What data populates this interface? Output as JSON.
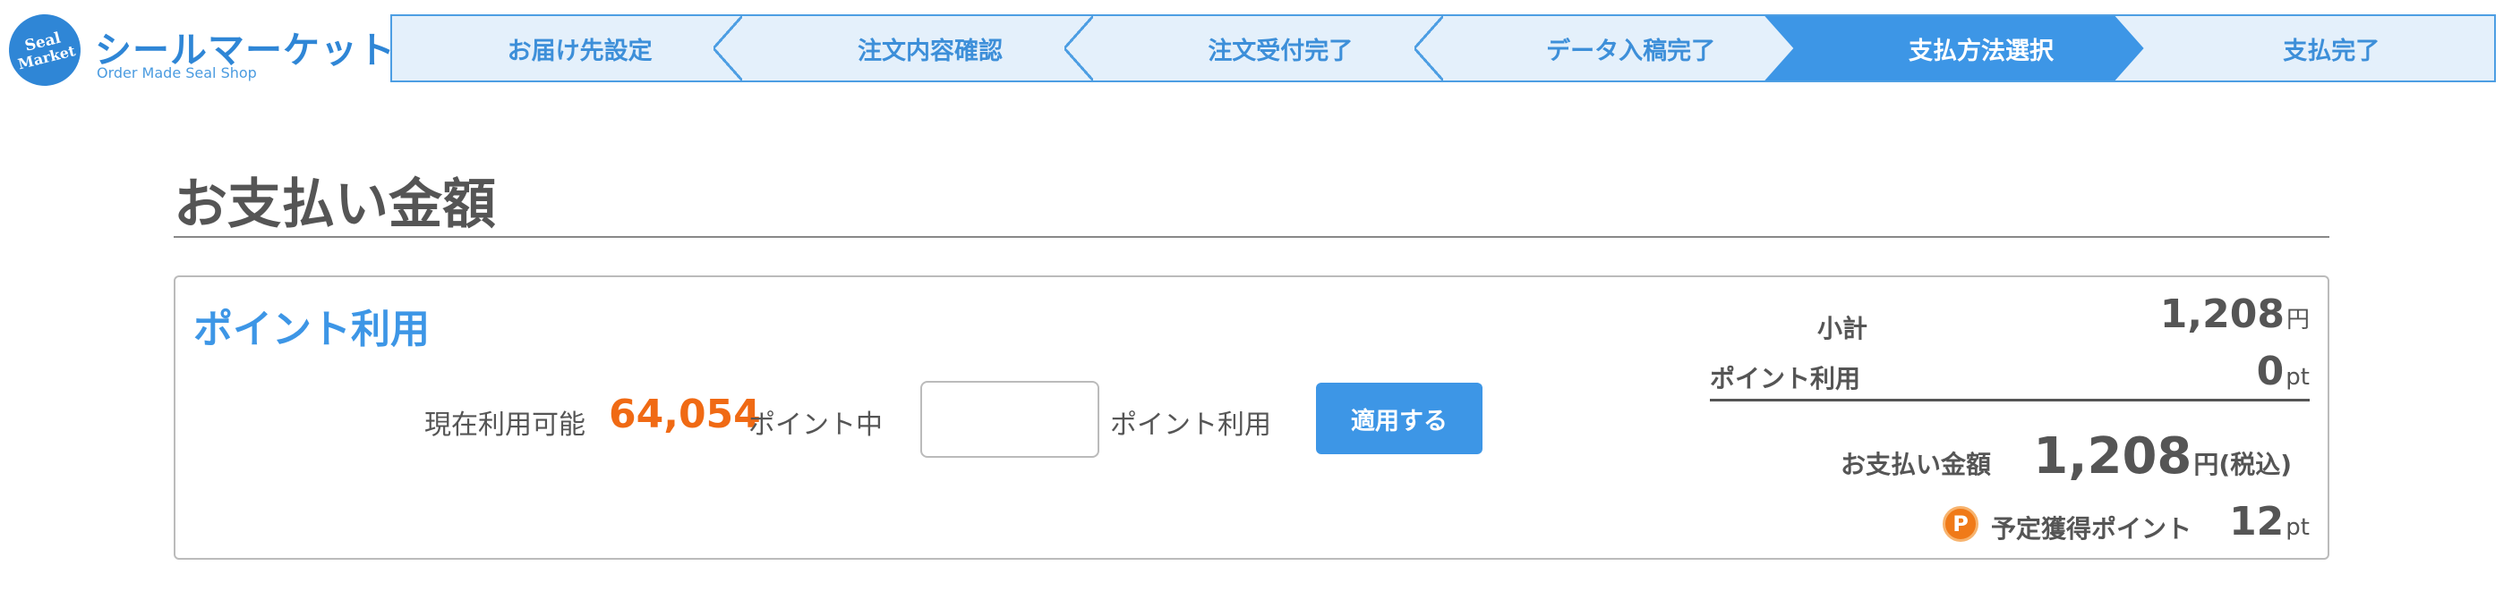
{
  "logo": {
    "badge_line1": "Seal",
    "badge_line2": "Market",
    "title": "シールマーケット",
    "subtitle": "Order Made Seal Shop"
  },
  "steps": [
    {
      "label": "お届け先設定",
      "active": false
    },
    {
      "label": "注文内容確認",
      "active": false
    },
    {
      "label": "注文受付完了",
      "active": false
    },
    {
      "label": "データ入稿完了",
      "active": false
    },
    {
      "label": "支払方法選択",
      "active": true
    },
    {
      "label": "支払完了",
      "active": false
    }
  ],
  "section": {
    "title": "お支払い金額"
  },
  "points_panel": {
    "title": "ポイント利用",
    "available_label": "現在利用可能",
    "available_value": "64,054",
    "available_suffix": "ポイント中",
    "input_value": "",
    "input_placeholder": "",
    "input_suffix": "ポイント利用",
    "apply_label": "適用する"
  },
  "summary": {
    "subtotal_label": "小計",
    "subtotal_value": "1,208",
    "subtotal_unit": "円",
    "points_used_label": "ポイント利用",
    "points_used_value": "0",
    "points_used_unit": "pt",
    "total_label": "お支払い金額",
    "total_value": "1,208",
    "total_unit": "円(税込)",
    "earn_icon": "P",
    "earn_label": "予定獲得ポイント",
    "earn_value": "12",
    "earn_unit": "pt"
  },
  "colors": {
    "accent": "#3d96e6",
    "step_bg": "#e4f0fb",
    "highlight_orange": "#f06a14",
    "text": "#555555"
  }
}
